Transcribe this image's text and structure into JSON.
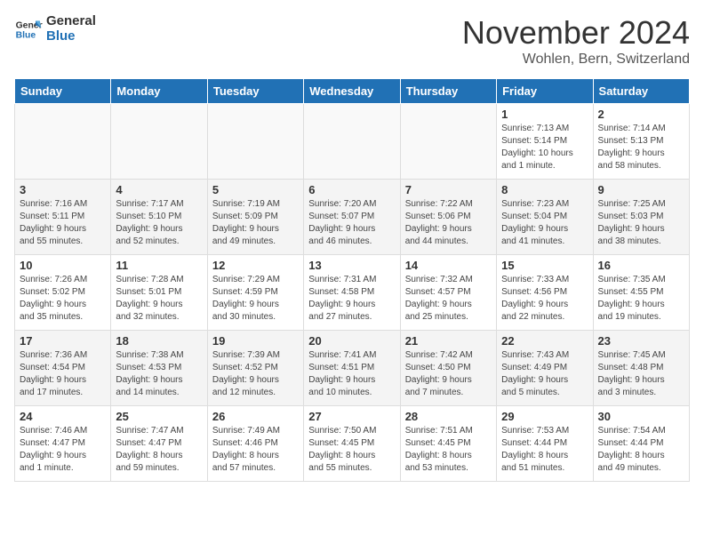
{
  "logo": {
    "line1": "General",
    "line2": "Blue"
  },
  "title": "November 2024",
  "location": "Wohlen, Bern, Switzerland",
  "weekdays": [
    "Sunday",
    "Monday",
    "Tuesday",
    "Wednesday",
    "Thursday",
    "Friday",
    "Saturday"
  ],
  "weeks": [
    [
      {
        "day": "",
        "detail": ""
      },
      {
        "day": "",
        "detail": ""
      },
      {
        "day": "",
        "detail": ""
      },
      {
        "day": "",
        "detail": ""
      },
      {
        "day": "",
        "detail": ""
      },
      {
        "day": "1",
        "detail": "Sunrise: 7:13 AM\nSunset: 5:14 PM\nDaylight: 10 hours\nand 1 minute."
      },
      {
        "day": "2",
        "detail": "Sunrise: 7:14 AM\nSunset: 5:13 PM\nDaylight: 9 hours\nand 58 minutes."
      }
    ],
    [
      {
        "day": "3",
        "detail": "Sunrise: 7:16 AM\nSunset: 5:11 PM\nDaylight: 9 hours\nand 55 minutes."
      },
      {
        "day": "4",
        "detail": "Sunrise: 7:17 AM\nSunset: 5:10 PM\nDaylight: 9 hours\nand 52 minutes."
      },
      {
        "day": "5",
        "detail": "Sunrise: 7:19 AM\nSunset: 5:09 PM\nDaylight: 9 hours\nand 49 minutes."
      },
      {
        "day": "6",
        "detail": "Sunrise: 7:20 AM\nSunset: 5:07 PM\nDaylight: 9 hours\nand 46 minutes."
      },
      {
        "day": "7",
        "detail": "Sunrise: 7:22 AM\nSunset: 5:06 PM\nDaylight: 9 hours\nand 44 minutes."
      },
      {
        "day": "8",
        "detail": "Sunrise: 7:23 AM\nSunset: 5:04 PM\nDaylight: 9 hours\nand 41 minutes."
      },
      {
        "day": "9",
        "detail": "Sunrise: 7:25 AM\nSunset: 5:03 PM\nDaylight: 9 hours\nand 38 minutes."
      }
    ],
    [
      {
        "day": "10",
        "detail": "Sunrise: 7:26 AM\nSunset: 5:02 PM\nDaylight: 9 hours\nand 35 minutes."
      },
      {
        "day": "11",
        "detail": "Sunrise: 7:28 AM\nSunset: 5:01 PM\nDaylight: 9 hours\nand 32 minutes."
      },
      {
        "day": "12",
        "detail": "Sunrise: 7:29 AM\nSunset: 4:59 PM\nDaylight: 9 hours\nand 30 minutes."
      },
      {
        "day": "13",
        "detail": "Sunrise: 7:31 AM\nSunset: 4:58 PM\nDaylight: 9 hours\nand 27 minutes."
      },
      {
        "day": "14",
        "detail": "Sunrise: 7:32 AM\nSunset: 4:57 PM\nDaylight: 9 hours\nand 25 minutes."
      },
      {
        "day": "15",
        "detail": "Sunrise: 7:33 AM\nSunset: 4:56 PM\nDaylight: 9 hours\nand 22 minutes."
      },
      {
        "day": "16",
        "detail": "Sunrise: 7:35 AM\nSunset: 4:55 PM\nDaylight: 9 hours\nand 19 minutes."
      }
    ],
    [
      {
        "day": "17",
        "detail": "Sunrise: 7:36 AM\nSunset: 4:54 PM\nDaylight: 9 hours\nand 17 minutes."
      },
      {
        "day": "18",
        "detail": "Sunrise: 7:38 AM\nSunset: 4:53 PM\nDaylight: 9 hours\nand 14 minutes."
      },
      {
        "day": "19",
        "detail": "Sunrise: 7:39 AM\nSunset: 4:52 PM\nDaylight: 9 hours\nand 12 minutes."
      },
      {
        "day": "20",
        "detail": "Sunrise: 7:41 AM\nSunset: 4:51 PM\nDaylight: 9 hours\nand 10 minutes."
      },
      {
        "day": "21",
        "detail": "Sunrise: 7:42 AM\nSunset: 4:50 PM\nDaylight: 9 hours\nand 7 minutes."
      },
      {
        "day": "22",
        "detail": "Sunrise: 7:43 AM\nSunset: 4:49 PM\nDaylight: 9 hours\nand 5 minutes."
      },
      {
        "day": "23",
        "detail": "Sunrise: 7:45 AM\nSunset: 4:48 PM\nDaylight: 9 hours\nand 3 minutes."
      }
    ],
    [
      {
        "day": "24",
        "detail": "Sunrise: 7:46 AM\nSunset: 4:47 PM\nDaylight: 9 hours\nand 1 minute."
      },
      {
        "day": "25",
        "detail": "Sunrise: 7:47 AM\nSunset: 4:47 PM\nDaylight: 8 hours\nand 59 minutes."
      },
      {
        "day": "26",
        "detail": "Sunrise: 7:49 AM\nSunset: 4:46 PM\nDaylight: 8 hours\nand 57 minutes."
      },
      {
        "day": "27",
        "detail": "Sunrise: 7:50 AM\nSunset: 4:45 PM\nDaylight: 8 hours\nand 55 minutes."
      },
      {
        "day": "28",
        "detail": "Sunrise: 7:51 AM\nSunset: 4:45 PM\nDaylight: 8 hours\nand 53 minutes."
      },
      {
        "day": "29",
        "detail": "Sunrise: 7:53 AM\nSunset: 4:44 PM\nDaylight: 8 hours\nand 51 minutes."
      },
      {
        "day": "30",
        "detail": "Sunrise: 7:54 AM\nSunset: 4:44 PM\nDaylight: 8 hours\nand 49 minutes."
      }
    ]
  ]
}
